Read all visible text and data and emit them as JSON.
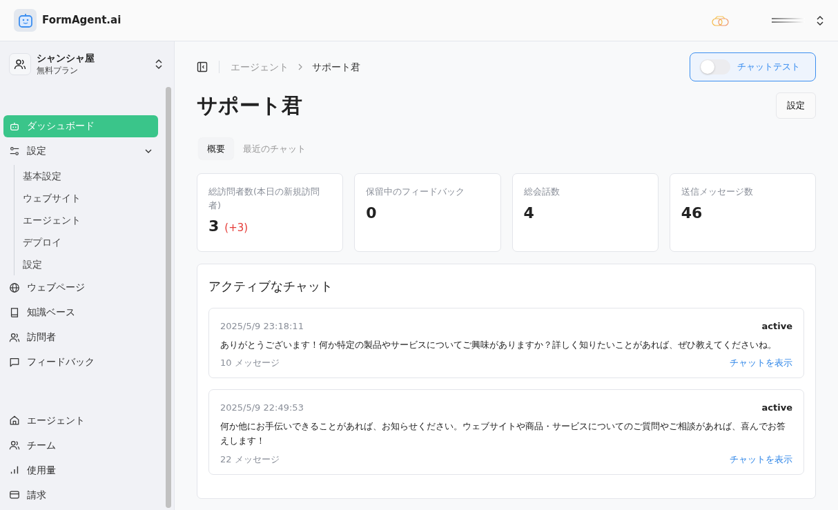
{
  "header": {
    "brand": "FormAgent.ai"
  },
  "workspace": {
    "name": "シャンシャ屋",
    "plan": "無料プラン"
  },
  "sidebar": {
    "items": [
      {
        "label": "ダッシュボード",
        "selected": true
      },
      {
        "label": "設定",
        "selected": false,
        "expanded": true,
        "children": [
          {
            "label": "基本設定"
          },
          {
            "label": "ウェブサイト"
          },
          {
            "label": "エージェント"
          },
          {
            "label": "デプロイ"
          },
          {
            "label": "設定"
          }
        ]
      },
      {
        "label": "ウェブページ",
        "selected": false
      },
      {
        "label": "知識ベース",
        "selected": false
      },
      {
        "label": "訪問者",
        "selected": false
      },
      {
        "label": "フィードバック",
        "selected": false
      }
    ],
    "bottom_items": [
      {
        "label": "エージェント"
      },
      {
        "label": "チーム"
      },
      {
        "label": "使用量"
      },
      {
        "label": "請求"
      }
    ]
  },
  "breadcrumb": [
    "エージェント",
    "サポート君"
  ],
  "chat_test": {
    "label": "チャットテスト",
    "on": false
  },
  "title": "サポート君",
  "settings_button": "設定",
  "tabs": [
    {
      "label": "概要",
      "selected": true
    },
    {
      "label": "最近のチャット",
      "selected": false
    }
  ],
  "stats": [
    {
      "label": "総訪問者数(本日の新規訪問者)",
      "value": "3",
      "delta": "(+3)"
    },
    {
      "label": "保留中のフィードバック",
      "value": "0"
    },
    {
      "label": "総会話数",
      "value": "4"
    },
    {
      "label": "送信メッセージ数",
      "value": "46"
    }
  ],
  "active_chats": {
    "title": "アクティブなチャット",
    "chats": [
      {
        "time": "2025/5/9 23:18:11",
        "status": "active",
        "message": "ありがとうございます！何か特定の製品やサービスについてご興味がありますか？詳しく知りたいことがあれば、ぜひ教えてくださいね。",
        "count": "10 メッセージ",
        "link": "チャットを表示"
      },
      {
        "time": "2025/5/9 22:49:53",
        "status": "active",
        "message": "何か他にお手伝いできることがあれば、お知らせください。ウェブサイトや商品・サービスについてのご質問やご相談があれば、喜んでお答えします！",
        "count": "22 メッセージ",
        "link": "チャットを表示"
      }
    ]
  }
}
